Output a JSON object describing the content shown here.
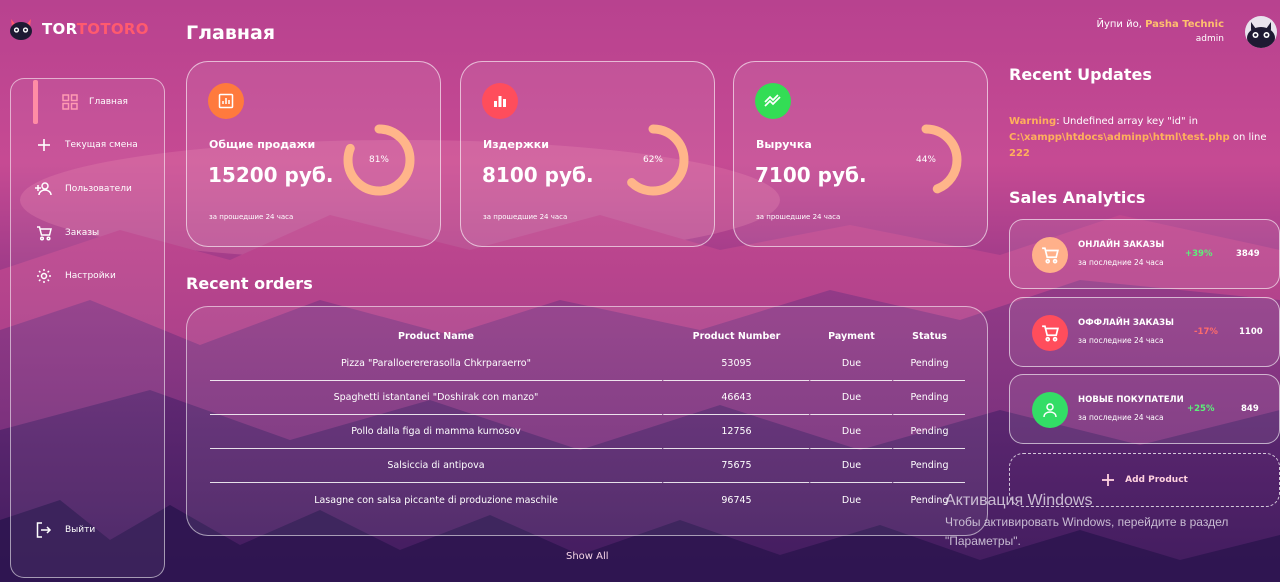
{
  "brand": {
    "part1": "TOR",
    "part2": "TOTORO"
  },
  "page_title": "Главная",
  "sidebar": {
    "items": [
      {
        "label": "Главная",
        "icon": "dashboard-icon"
      },
      {
        "label": "Текущая смена",
        "icon": "plus-icon"
      },
      {
        "label": "Пользователи",
        "icon": "add-user-icon"
      },
      {
        "label": "Заказы",
        "icon": "cart-icon"
      },
      {
        "label": "Настройки",
        "icon": "gear-icon"
      }
    ],
    "logout_label": "Выйти"
  },
  "cards": [
    {
      "title": "Общие продажи",
      "value": "15200 руб.",
      "percent_label": "81%",
      "percent": 81,
      "sub": "за прошедшие 24 часа",
      "icon": "chart-icon",
      "color": "#ff7a3d"
    },
    {
      "title": "Издержки",
      "value": "8100 руб.",
      "percent_label": "62%",
      "percent": 62,
      "sub": "за прошедшие 24 часа",
      "icon": "bar-chart-icon",
      "color": "#ff4d5c"
    },
    {
      "title": "Выручка",
      "value": "7100 руб.",
      "percent_label": "44%",
      "percent": 44,
      "sub": "за прошедшие 24 часа",
      "icon": "trending-up-icon",
      "color": "#33dd55"
    }
  ],
  "recent_orders": {
    "title": "Recent orders",
    "columns": [
      "Product Name",
      "Product Number",
      "Payment",
      "Status"
    ],
    "rows": [
      [
        "Pizza \"Paralloerererasolla Chkrparaerro\"",
        "53095",
        "Due",
        "Pending"
      ],
      [
        "Spaghetti istantanei \"Doshirak con manzo\"",
        "46643",
        "Due",
        "Pending"
      ],
      [
        "Pollo dalla figa di mamma kurnosov",
        "12756",
        "Due",
        "Pending"
      ],
      [
        "Salsiccia di antipova",
        "75675",
        "Due",
        "Pending"
      ],
      [
        "Lasagne con salsa piccante di produzione maschile",
        "96745",
        "Due",
        "Pending"
      ]
    ],
    "show_all": "Show All"
  },
  "user": {
    "greeting": "Йупи йо, ",
    "name": "Pasha Technic",
    "role": "admin"
  },
  "recent_updates": {
    "title": "Recent Updates",
    "warning_label": "Warning",
    "message": ": Undefined array key \"id\" in ",
    "path": "C:\\xampp\\htdocs\\adminp\\html\\test.php",
    "on_line": " on line ",
    "line": "222"
  },
  "sales_analytics": {
    "title": "Sales Analytics",
    "items": [
      {
        "title": "ОНЛАЙН ЗАКАЗЫ",
        "sub": "за последние 24 часа",
        "pct": "+39%",
        "value": "3849",
        "icon": "cart-icon",
        "color": "#ff9e7a",
        "pct_color": "#5cf07a"
      },
      {
        "title": "ОФФЛАЙН ЗАКАЗЫ",
        "sub": "за последние 24 часа",
        "pct": "-17%",
        "value": "1100",
        "icon": "cart-icon",
        "color": "#ff4d5c",
        "pct_color": "#ff6b6b"
      },
      {
        "title": "НОВЫЕ ПОКУПАТЕЛИ",
        "sub": "за последние 24 часа",
        "pct": "+25%",
        "value": "849",
        "icon": "user-icon",
        "color": "#33dd66",
        "pct_color": "#5cf07a"
      }
    ],
    "add_product": "Add Product"
  },
  "windows_activation": {
    "title": "Активация Windows",
    "text": "Чтобы активировать Windows, перейдите в раздел \"Параметры\"."
  }
}
